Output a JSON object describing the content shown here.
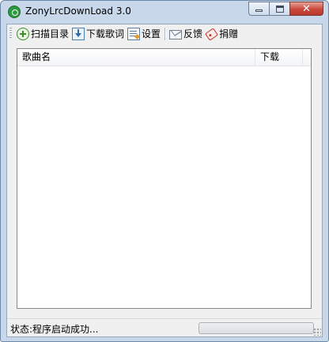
{
  "window": {
    "title": "ZonyLrcDownLoad 3.0"
  },
  "toolbar": {
    "scan_label": "扫描目录",
    "download_label": "下载歌词",
    "settings_label": "设置",
    "feedback_label": "反馈",
    "donate_label": "捐赠"
  },
  "list": {
    "columns": [
      "歌曲名",
      "下载"
    ],
    "rows": []
  },
  "status": {
    "text": "状态:程序启动成功...",
    "progress": 0
  },
  "colors": {
    "app_icon": "#2d9a43",
    "close_button": "#c9483a",
    "frame": "#c8d8ea",
    "client": "#f0f0f0"
  },
  "icons": {
    "app": "green-circle-icon",
    "scan": "plus-circle-icon",
    "download": "download-arrow-icon",
    "settings": "document-settings-icon",
    "feedback": "envelope-icon",
    "donate": "tag-icon"
  }
}
